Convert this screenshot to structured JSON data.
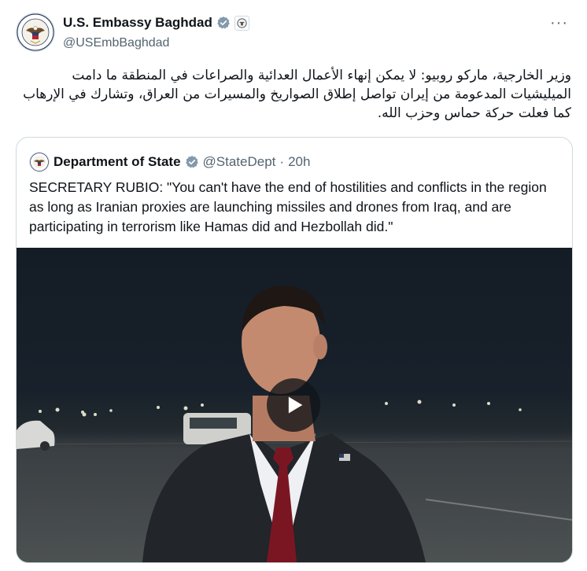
{
  "tweet": {
    "author_name": "U.S. Embassy Baghdad",
    "author_handle": "@USEmbBaghdad",
    "more_label": "···",
    "text": "وزير الخارجية، ماركو روبيو: لا يمكن إنهاء الأعمال العدائية والصراعات في المنطقة ما دامت الميليشيات المدعومة من إيران تواصل إطلاق الصواريخ والمسيرات من العراق، وتشارك في الإرهاب كما فعلت حركة حماس وحزب الله."
  },
  "quoted": {
    "author_name": "Department of State",
    "author_handle": "@StateDept",
    "separator": "·",
    "time": "20h",
    "text": "SECRETARY RUBIO: \"You can't have the end of hostilities and conflicts in the region as long as Iranian proxies are launching missiles and drones from Iraq, and are participating in terrorism like Hamas did and Hezbollah did.\""
  },
  "icons": {
    "verified": "verified-badge-icon",
    "affiliate": "embassy-seal-affiliate-icon",
    "play": "play-icon",
    "more": "more-options-icon"
  },
  "colors": {
    "verified_badge": "#829aab",
    "text_primary": "#0f1419",
    "text_secondary": "#536471",
    "border": "#cfd9de"
  }
}
